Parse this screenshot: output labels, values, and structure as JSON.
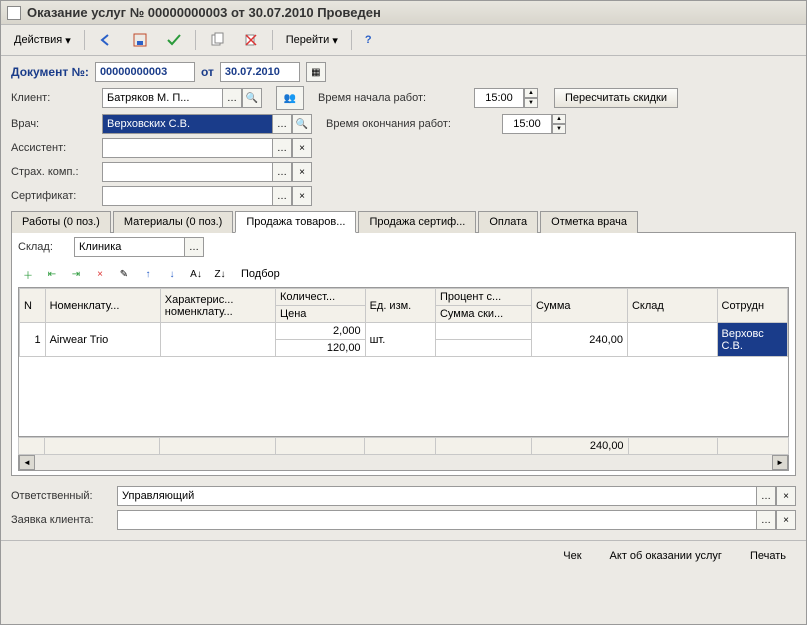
{
  "title": "Оказание услуг № 00000000003 от 30.07.2010 Проведен",
  "toolbar": {
    "actions_label": "Действия",
    "goto_label": "Перейти"
  },
  "doc": {
    "label": "Документ №:",
    "number": "00000000003",
    "from_label": "от",
    "date": "30.07.2010"
  },
  "fields": {
    "client_label": "Клиент:",
    "client_value": "Батряков М. П...",
    "doctor_label": "Врач:",
    "doctor_value": "Верховских С.В.",
    "assistant_label": "Ассистент:",
    "assistant_value": "",
    "insurance_label": "Страх. комп.:",
    "insurance_value": "",
    "certificate_label": "Сертификат:",
    "certificate_value": "",
    "start_label": "Время начала работ:",
    "start_value": "15:00",
    "end_label": "Время окончания работ:",
    "end_value": "15:00",
    "recalc_btn": "Пересчитать скидки"
  },
  "tabs": [
    "Работы (0 поз.)",
    "Материалы (0 поз.)",
    "Продажа товаров...",
    "Продажа сертиф...",
    "Оплата",
    "Отметка врача"
  ],
  "active_tab": 2,
  "warehouse": {
    "label": "Склад:",
    "value": "Клиника"
  },
  "podbor_label": "Подбор",
  "grid": {
    "headers": {
      "n": "N",
      "nomenclature": "Номенклату...",
      "char": "Характерис... номенклату...",
      "qty": "Количест...",
      "price": "Цена",
      "unit": "Ед. изм.",
      "discount_pct": "Процент с...",
      "discount_sum": "Сумма ски...",
      "sum": "Сумма",
      "warehouse": "Склад",
      "employee": "Сотрудн"
    },
    "rows": [
      {
        "n": "1",
        "nomenclature": "Airwear Trio",
        "char": "",
        "qty": "2,000",
        "price": "120,00",
        "unit": "шт.",
        "discount_pct": "",
        "discount_sum": "",
        "sum": "240,00",
        "warehouse": "",
        "employee": "Верховс С.В."
      }
    ],
    "totals": {
      "sum": "240,00"
    }
  },
  "bottom": {
    "responsible_label": "Ответственный:",
    "responsible_value": "Управляющий",
    "request_label": "Заявка клиента:",
    "request_value": ""
  },
  "footer": {
    "check": "Чек",
    "act": "Акт об оказании услуг",
    "print": "Печать"
  }
}
